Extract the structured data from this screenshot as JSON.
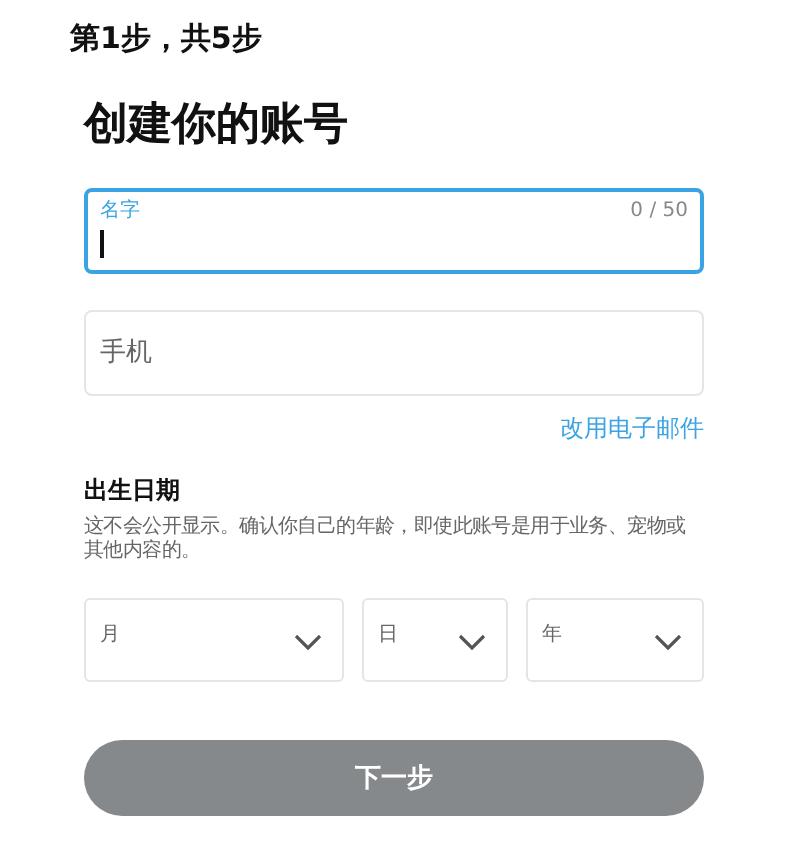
{
  "step": "第1步，共5步",
  "title": "创建你的账号",
  "name_field": {
    "label": "名字",
    "counter": "0 / 50",
    "focused": true
  },
  "phone_field": {
    "placeholder": "手机",
    "focused": false
  },
  "switch_link": "改用电子邮件",
  "birth_date": {
    "heading": "出生日期",
    "description": "这不会公开显示。确认你自己的年龄，即使此账号是用于业务、宠物或其他内容的。",
    "selects": [
      {
        "label": "月"
      },
      {
        "label": "日"
      },
      {
        "label": "年"
      }
    ]
  },
  "next_button": {
    "label": "下一步",
    "disabled": true
  }
}
